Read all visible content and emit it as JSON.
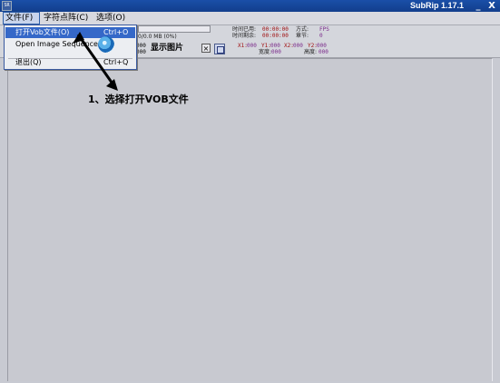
{
  "window": {
    "title": "SubRip 1.17.1",
    "app_icon": "SR",
    "minimize": "_",
    "close": "X"
  },
  "menubar": [
    {
      "label": "文件(F)"
    },
    {
      "label": "字符点阵(C)"
    },
    {
      "label": "选项(O)"
    }
  ],
  "file_menu": {
    "items": [
      {
        "label": "打开Vob文件(O)",
        "shortcut": "Ctrl+O"
      },
      {
        "label": "Open Image Sequence",
        "shortcut": ""
      },
      {
        "label": "退出(Q)",
        "shortcut": "Ctrl+Q"
      }
    ]
  },
  "status": {
    "size_text": "0/0.0 MB (0%)",
    "elapsed_label": "时间已用:",
    "elapsed_value": "00:00:00",
    "remaining_label": "时间剩余:",
    "remaining_value": "00:00:00",
    "mode_label": "方式:",
    "mode_value": "FPS",
    "chapter_label": "章节:",
    "chapter_value": "0",
    "left_num_1": "000",
    "left_num_2": "000"
  },
  "image_panel": {
    "show_image_label": "显示图片",
    "x1_label": "X1:",
    "x1_value": "000",
    "y1_label": "Y1:",
    "y1_value": "000",
    "x2_label": "X2:",
    "x2_value": "000",
    "y2_label": "Y2:",
    "y2_value": "000",
    "width_label": "宽度:",
    "width_value": "000",
    "height_label": "高度:",
    "height_value": "000",
    "close_glyph": "×"
  },
  "annotation": {
    "text": "1、选择打开VOB文件"
  },
  "colors": {
    "titlebar": "#1a4fa8",
    "menu_highlight": "#3568c8",
    "value_red": "#a01010",
    "value_purple": "#7a2a8a"
  }
}
